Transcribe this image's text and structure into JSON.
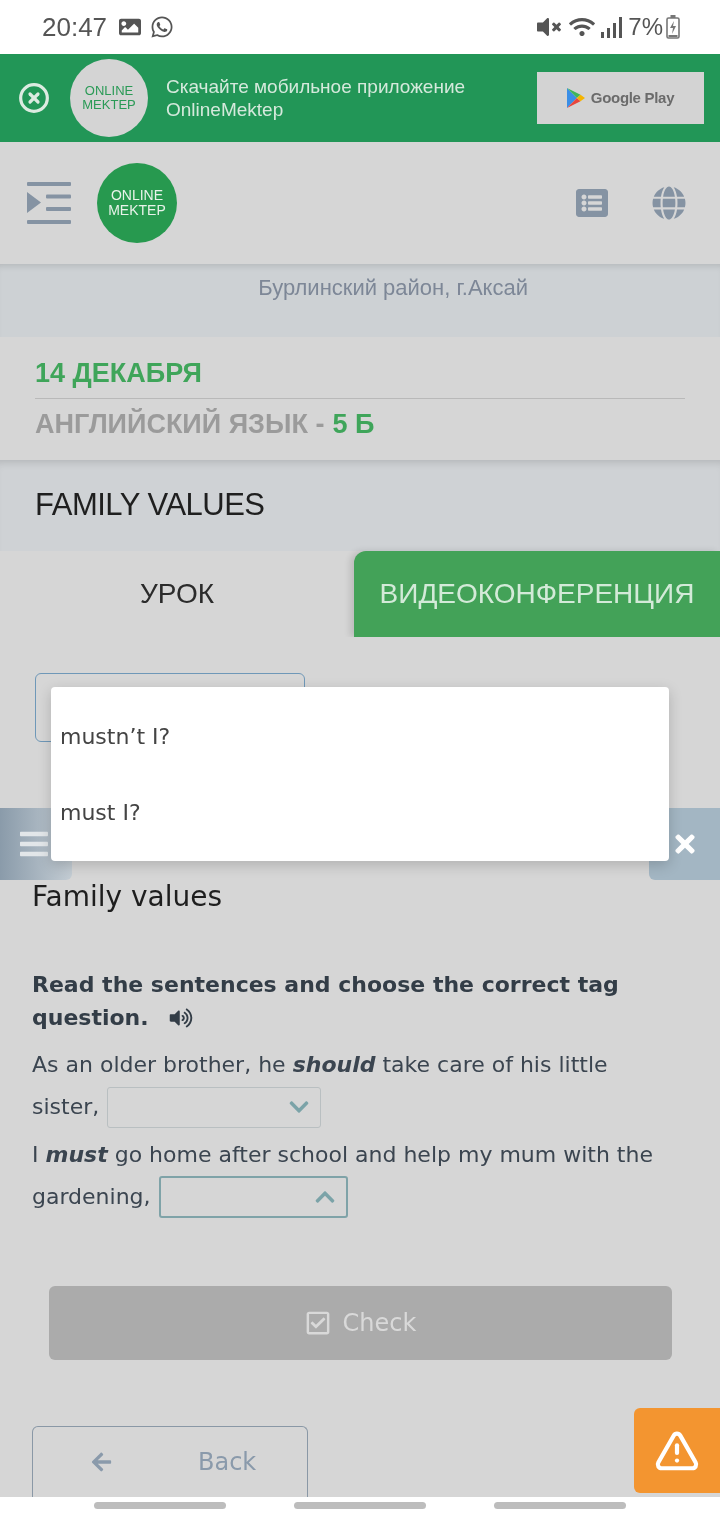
{
  "status_bar": {
    "time": "20:47",
    "battery": "7%"
  },
  "app_banner": {
    "logo": "ONLINE MEKTEP",
    "message": "Скачайте мобильное приложение OnlineMektep",
    "store_button": "Google Play"
  },
  "header": {
    "logo": "ONLINE MEKTEP"
  },
  "school_address": "Бурлинский район, г.Аксай",
  "lesson": {
    "date": "14 ДЕКАБРЯ",
    "subject": "АНГЛИЙСКИЙ ЯЗЫК -",
    "class": "5 Б",
    "title": "FAMILY VALUES"
  },
  "tabs": [
    {
      "label": "УРОК",
      "selected": true
    },
    {
      "label": "ВИДЕОКОНФЕРЕНЦИЯ",
      "selected": false
    }
  ],
  "dropdown_list": {
    "options": [
      "mustn’t I?",
      "must I?"
    ]
  },
  "exercise": {
    "title": "Family values",
    "instruction_lines": [
      "Read the sentences and choose the correct tag",
      "question."
    ],
    "sentences": [
      {
        "lines": [
          "As an older brother, he **should** take care of his little",
          "sister,"
        ],
        "expanded": false
      },
      {
        "lines": [
          "I **must** go home after school and help my mum with the",
          "gardening,"
        ],
        "expanded": true
      }
    ]
  },
  "check_button": {
    "label": "Check",
    "disabled": true
  },
  "back_button": {
    "label": "Back"
  }
}
